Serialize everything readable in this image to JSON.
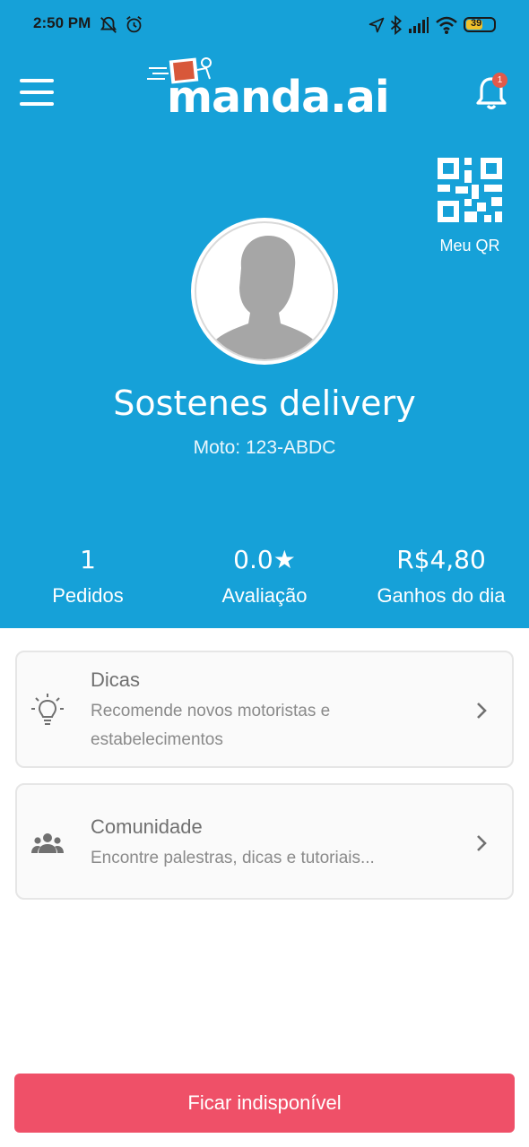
{
  "status_bar": {
    "time": "2:50 PM",
    "battery": "39"
  },
  "app": {
    "logo_text": "manda.ai",
    "notification_count": "1",
    "qr_label": "Meu QR"
  },
  "profile": {
    "name": "Sostenes delivery",
    "vehicle": "Moto: 123-ABDC"
  },
  "stats": [
    {
      "value": "1",
      "label": "Pedidos"
    },
    {
      "value": "0.0★",
      "label": "Avaliação"
    },
    {
      "value": "R$4,80",
      "label": "Ganhos do dia"
    }
  ],
  "cards": [
    {
      "icon": "lightbulb-icon",
      "title": "Dicas",
      "description": "Recomende novos motoristas e estabelecimentos"
    },
    {
      "icon": "people-icon",
      "title": "Comunidade",
      "description": "Encontre palestras, dicas e tutoriais..."
    }
  ],
  "footer": {
    "button_label": "Ficar indisponível"
  },
  "colors": {
    "primary": "#16a1d8",
    "danger": "#ef5068",
    "badge": "#e25a4a"
  }
}
